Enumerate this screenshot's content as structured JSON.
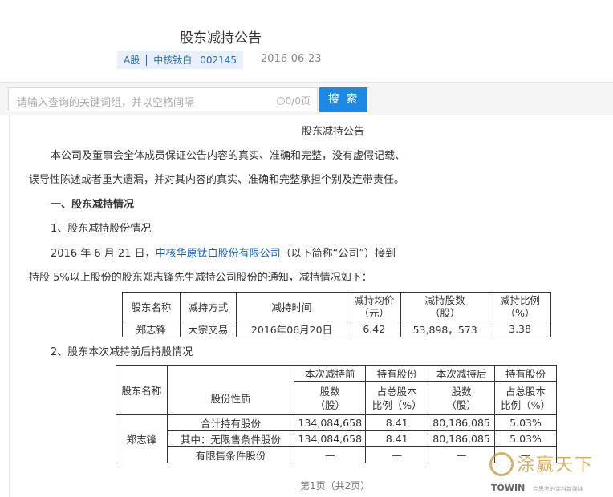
{
  "header": {
    "title": "股东减持公告",
    "market": "A股",
    "company": "中核钛白",
    "code": "002145",
    "date": "2016-06-23"
  },
  "search": {
    "placeholder": "请输入查询的关键词组，并以空格间隔",
    "count": "0/0页",
    "button": "搜 索"
  },
  "doc": {
    "title": "股东减持公告",
    "para1_line1": "本公司及董事会全体成员保证公告内容的真实、准确和完整，没有虚假记载、",
    "para1_line2": "误导性陈述或者重大遗漏，并对其内容的真实、准确和完整承担个别及连带责任。",
    "section1": "一、股东减持情况",
    "sub1": "1、股东减持股份情况",
    "para2_pre": "2016 年 6 月 21 日，",
    "para2_link": "中核华原钛白股份有限公司",
    "para2_post": "（以下简称“公司”）接到",
    "para3": "持股 5%以上股份的股东郑志锋先生减持公司股份的通知，减持情况如下：",
    "sub2": "2、股东本次减持前后持股情况"
  },
  "table1": {
    "headers": [
      "股东名称",
      "减持方式",
      "减持时间",
      "减持均价",
      "（元）",
      "减持股数",
      "（股）",
      "减持比例",
      "（%）"
    ],
    "row": [
      "郑志锋",
      "大宗交易",
      "2016年06月20日",
      "6.42",
      "53,898，573",
      "3.38"
    ]
  },
  "table2": {
    "h_before": "本次减持前",
    "h_hold1": "持有股份",
    "h_after": "本次减持后",
    "h_hold2": "持有股份",
    "col_name": "股东名称",
    "col_type": "股份性质",
    "sub_shares": "股数",
    "sub_unit": "（股）",
    "sub_pct1": "占总股本",
    "sub_pct2": "比例（%）",
    "shareholder": "郑志锋",
    "rows": [
      [
        "合计持有股份",
        "134,084,658",
        "8.41",
        "80,186,085",
        "5.03%"
      ],
      [
        "其中：无限售条件股份",
        "134,084,658",
        "8.41",
        "80,186,085",
        "5.03%"
      ],
      [
        "有限售条件股份",
        "—",
        "—",
        "—",
        "—"
      ]
    ]
  },
  "pager": "第1页（共2页）",
  "watermark": {
    "main": "涂赢天下",
    "brand": "TOWIN",
    "sub": "会思考的涂料新媒体"
  }
}
